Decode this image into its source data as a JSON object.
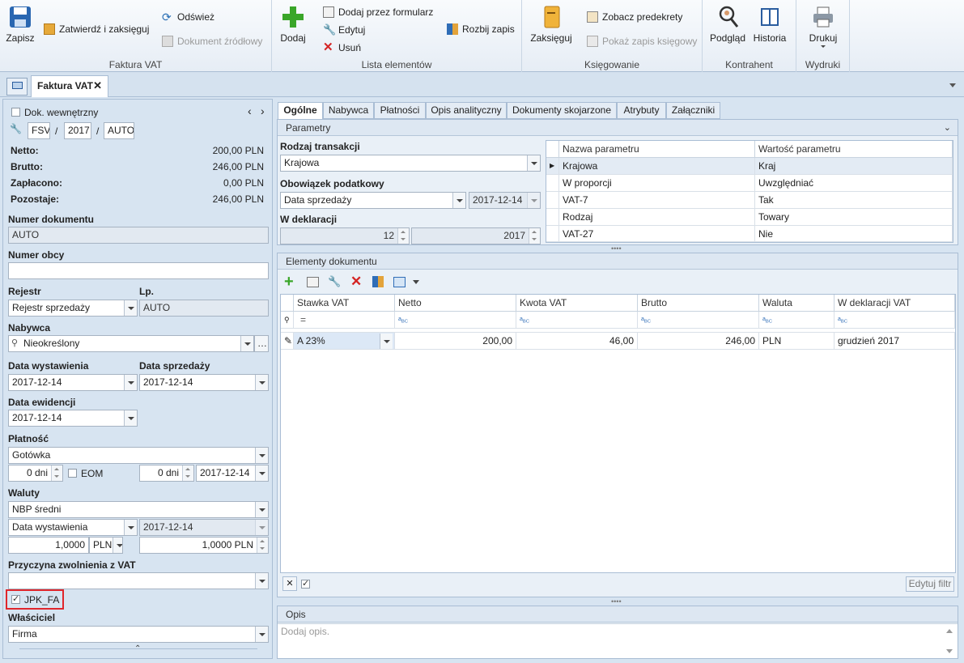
{
  "ribbon": {
    "groups": {
      "faktura": "Faktura VAT",
      "lista": "Lista elementów",
      "ksiegowanie": "Księgowanie",
      "kontrahent": "Kontrahent",
      "wydruki": "Wydruki"
    },
    "buttons": {
      "zapisz": "Zapisz",
      "zatwierdz": "Zatwierdź i zaksięguj",
      "odswiez": "Odśwież",
      "dokument_zrodlowy": "Dokument źródłowy",
      "dodaj": "Dodaj",
      "dodaj_formularz": "Dodaj przez formularz",
      "edytuj": "Edytuj",
      "usun": "Usuń",
      "rozbij": "Rozbij zapis",
      "zaksieguj": "Zaksięguj",
      "predekrety": "Zobacz predekrety",
      "pokaz_zapis": "Pokaż zapis księgowy",
      "podglad": "Podgląd",
      "historia": "Historia",
      "drukuj": "Drukuj"
    }
  },
  "doc_tab": {
    "title": "Faktura VAT"
  },
  "left": {
    "dok_wewnetrzny": "Dok. wewnętrzny",
    "prefix": "FSV",
    "sep1": "/",
    "year": "2017",
    "sep2": "/",
    "number": "AUTO",
    "summary": [
      {
        "label": "Netto:",
        "value": "200,00 PLN"
      },
      {
        "label": "Brutto:",
        "value": "246,00 PLN"
      },
      {
        "label": "Zapłacono:",
        "value": "0,00 PLN"
      },
      {
        "label": "Pozostaje:",
        "value": "246,00 PLN"
      }
    ],
    "numer_dokumentu_label": "Numer dokumentu",
    "numer_dokumentu": "AUTO",
    "numer_obcy_label": "Numer obcy",
    "numer_obcy": "",
    "rejestr_label": "Rejestr",
    "rejestr": "Rejestr sprzedaży",
    "lp_label": "Lp.",
    "lp": "AUTO",
    "nabywca_label": "Nabywca",
    "nabywca": "Nieokreślony",
    "data_wyst_label": "Data wystawienia",
    "data_wyst": "2017-12-14",
    "data_sprz_label": "Data sprzedaży",
    "data_sprz": "2017-12-14",
    "data_ew_label": "Data ewidencji",
    "data_ew": "2017-12-14",
    "platnosc_label": "Płatność",
    "platnosc": "Gotówka",
    "dni1": "0 dni",
    "eom": "EOM",
    "dni2": "0 dni",
    "termin": "2017-12-14",
    "waluty_label": "Waluty",
    "waluta": "NBP średni",
    "kurs_z": "Data wystawienia",
    "kurs_data": "2017-12-14",
    "kurs1": "1,0000",
    "kurs_waluta": "PLN",
    "kurs2": "1,0000 PLN",
    "przyczyna_label": "Przyczyna zwolnienia z VAT",
    "przyczyna": "",
    "jpk": "JPK_FA",
    "wlasciciel_label": "Właściciel",
    "wlasciciel": "Firma"
  },
  "tabs": [
    "Ogólne",
    "Nabywca",
    "Płatności",
    "Opis analityczny",
    "Dokumenty skojarzone",
    "Atrybuty",
    "Załączniki"
  ],
  "parametry": {
    "title": "Parametry",
    "rodzaj_label": "Rodzaj transakcji",
    "rodzaj": "Krajowa",
    "obowiazek_label": "Obowiązek podatkowy",
    "obowiazek": "Data sprzedaży",
    "obowiazek_data": "2017-12-14",
    "deklaracja_label": "W deklaracji",
    "dekl_miesiac": "12",
    "dekl_rok": "2017",
    "grid_headers": [
      "Nazwa parametru",
      "Wartość parametru"
    ],
    "grid_rows": [
      [
        "Krajowa",
        "Kraj"
      ],
      [
        "W proporcji",
        "Uwzględniać"
      ],
      [
        "VAT-7",
        "Tak"
      ],
      [
        "Rodzaj",
        "Towary"
      ],
      [
        "VAT-27",
        "Nie"
      ]
    ]
  },
  "elementy": {
    "title": "Elementy dokumentu",
    "headers": [
      "Stawka VAT",
      "Netto",
      "Kwota VAT",
      "Brutto",
      "Waluta",
      "W deklaracji VAT"
    ],
    "filter_eq": "=",
    "row": [
      "A 23%",
      "200,00",
      "46,00",
      "246,00",
      "PLN",
      "grudzień 2017"
    ],
    "edit_filter": "Edytuj filtr"
  },
  "opis": {
    "title": "Opis",
    "placeholder": "Dodaj opis."
  }
}
